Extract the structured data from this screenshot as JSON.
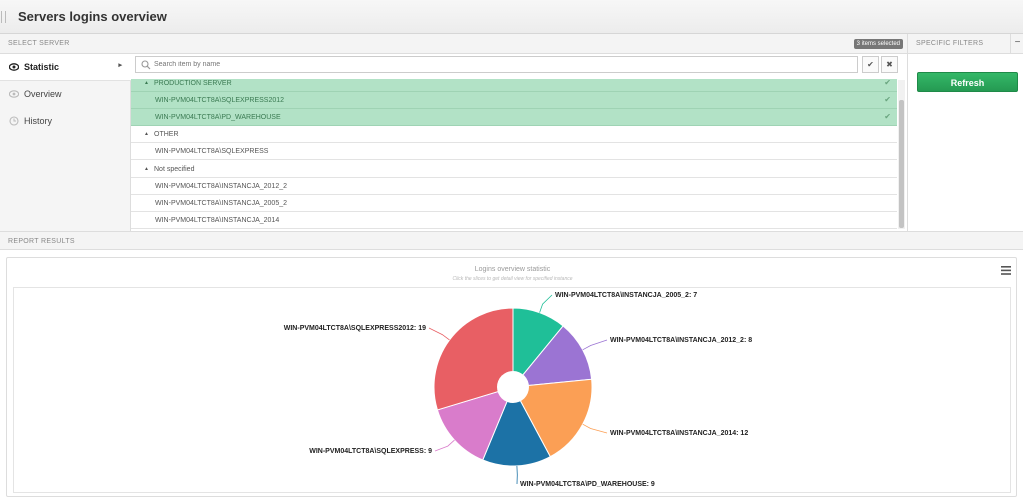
{
  "header": {
    "title": "Servers logins overview"
  },
  "select_server": {
    "label": "SELECT SERVER",
    "badge": "3 items selected"
  },
  "sidebar": {
    "items": [
      {
        "label": "Statistic",
        "icon": "eye-icon",
        "active": true
      },
      {
        "label": "Overview",
        "icon": "eye-icon",
        "active": false
      },
      {
        "label": "History",
        "icon": "history-icon",
        "active": false
      }
    ]
  },
  "search": {
    "placeholder": "Search item by name",
    "value": ""
  },
  "groups": [
    {
      "label": "PRODUCTION SERVER",
      "selected": true
    },
    {
      "label": "OTHER",
      "selected": false
    },
    {
      "label": "Not specified",
      "selected": false
    }
  ],
  "servers": [
    {
      "label": "WIN-PVM04LTCT8A\\SQLEXPRESS2012",
      "selected": true
    },
    {
      "label": "WIN-PVM04LTCT8A\\PD_WAREHOUSE",
      "selected": true
    },
    {
      "label": "WIN-PVM04LTCT8A\\SQLEXPRESS",
      "selected": false
    },
    {
      "label": "WIN-PVM04LTCT8A\\INSTANCJA_2012_2",
      "selected": false
    },
    {
      "label": "WIN-PVM04LTCT8A\\INSTANCJA_2005_2",
      "selected": false
    },
    {
      "label": "WIN-PVM04LTCT8A\\INSTANCJA_2014",
      "selected": false
    }
  ],
  "filters": {
    "label": "SPECIFIC FILTERS",
    "refresh_label": "Refresh"
  },
  "results": {
    "label": "REPORT RESULTS"
  },
  "chart_data": {
    "type": "pie",
    "title": "Logins overview statistic",
    "subtitle": "Click the slices to get detail view for specified instance",
    "donut_hole": true,
    "slices": [
      {
        "name": "WIN-PVM04LTCT8A\\INSTANCJA_2005_2",
        "value": 7,
        "label": "WIN-PVM04LTCT8A\\INSTANCJA_2005_2: 7",
        "color": "#1fbf98"
      },
      {
        "name": "WIN-PVM04LTCT8A\\INSTANCJA_2012_2",
        "value": 8,
        "label": "WIN-PVM04LTCT8A\\INSTANCJA_2012_2: 8",
        "color": "#9b74d3"
      },
      {
        "name": "WIN-PVM04LTCT8A\\INSTANCJA_2014",
        "value": 12,
        "label": "WIN-PVM04LTCT8A\\INSTANCJA_2014: 12",
        "color": "#fb9f55"
      },
      {
        "name": "WIN-PVM04LTCT8A\\PD_WAREHOUSE",
        "value": 9,
        "label": "WIN-PVM04LTCT8A\\PD_WAREHOUSE: 9",
        "color": "#1c72a6"
      },
      {
        "name": "WIN-PVM04LTCT8A\\SQLEXPRESS",
        "value": 9,
        "label": "WIN-PVM04LTCT8A\\SQLEXPRESS: 9",
        "color": "#d97ccb"
      },
      {
        "name": "WIN-PVM04LTCT8A\\SQLEXPRESS2012",
        "value": 19,
        "label": "WIN-PVM04LTCT8A\\SQLEXPRESS2012: 19",
        "color": "#e85f64"
      }
    ]
  }
}
